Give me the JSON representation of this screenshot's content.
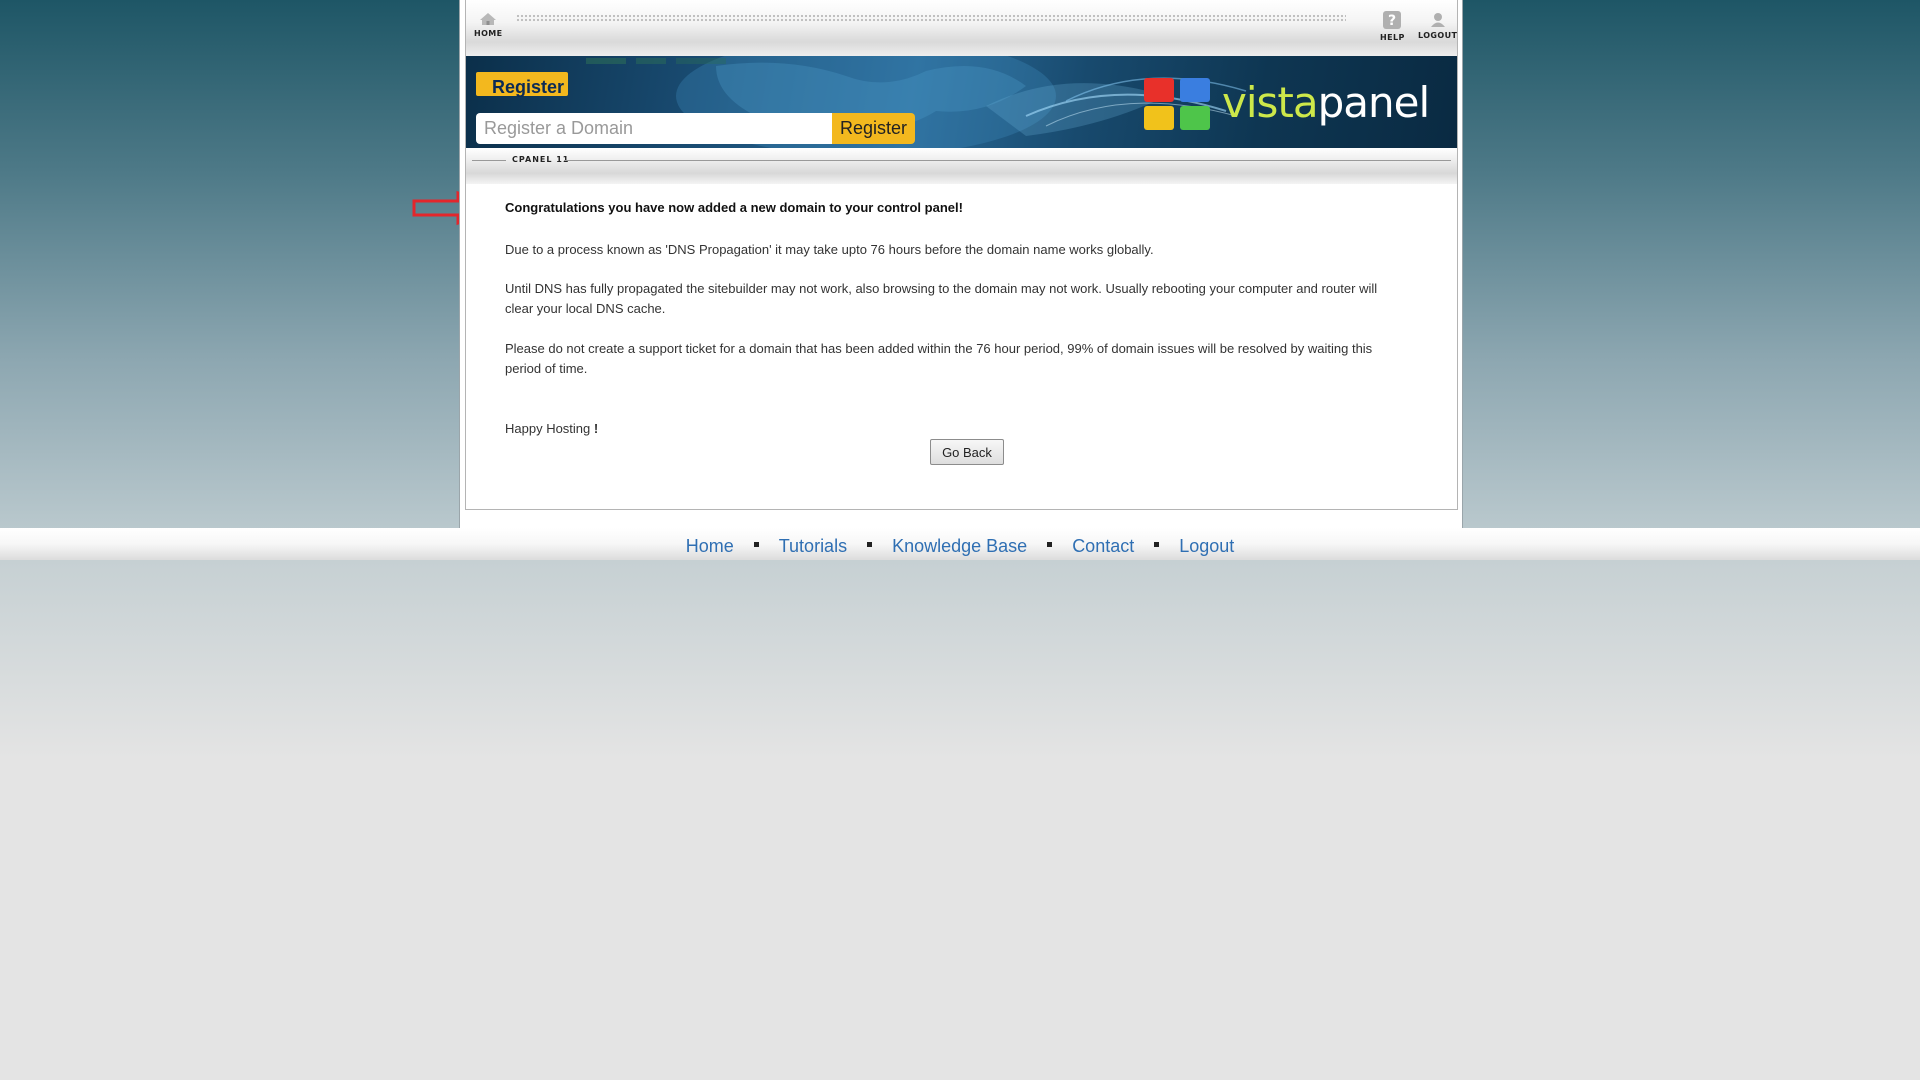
{
  "toolbar": {
    "home_label": "HOME",
    "help_label": "HELP",
    "logout_label": "LOGOUT"
  },
  "banner": {
    "tag_label": "Register",
    "domain_input_placeholder": "Register a Domain",
    "domain_input_value": "",
    "register_button_label": "Register",
    "logo_prefix": "vista",
    "logo_suffix": "panel"
  },
  "subbar": {
    "label": "CPANEL 11"
  },
  "message": {
    "headline": "Congratulations you have now added a new domain to your control panel!",
    "para1": "Due to a process known as 'DNS Propagation' it may take upto 76 hours before the domain name works globally.",
    "para2": "Until DNS has fully propagated the sitebuilder may not work, also browsing to the domain may not work. Usually rebooting your computer and router will clear your local DNS cache.",
    "para3": "Please do not create a support ticket for a domain that has been added within the 76 hour period, 99% of domain issues will be resolved by waiting this period of time.",
    "closing": "Happy Hosting",
    "closing_mark": "!",
    "go_back_label": "Go Back"
  },
  "footer": {
    "links": [
      "Home",
      "Tutorials",
      "Knowledge Base",
      "Contact",
      "Logout"
    ]
  },
  "colors": {
    "accent": "#f3b81e",
    "link": "#2f6fb3",
    "annotation_arrow": "#e3262c"
  }
}
